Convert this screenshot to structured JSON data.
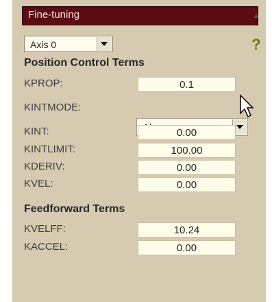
{
  "panel": {
    "title": "Fine-tuning",
    "axis_select": {
      "value": "Axis 0"
    }
  },
  "sections": {
    "position": {
      "title": "Position Control Terms",
      "kprop": {
        "label": "KPROP:",
        "value": "0.1"
      },
      "kintmode": {
        "label": "KINTMODE:",
        "value": "Always"
      },
      "kint": {
        "label": "KINT:",
        "value": "0.00"
      },
      "kintlimit": {
        "label": "KINTLIMIT:",
        "value": "100.00"
      },
      "kderiv": {
        "label": "KDERIV:",
        "value": "0.00"
      },
      "kvel": {
        "label": "KVEL:",
        "value": "0.00"
      }
    },
    "feedforward": {
      "title": "Feedforward Terms",
      "kvelff": {
        "label": "KVELFF:",
        "value": "10.24"
      },
      "kaccel": {
        "label": "KACCEL:",
        "value": "0.00"
      }
    }
  },
  "colors": {
    "panel_bg": "#d6cbb0",
    "titlebar_bg": "#5a0c12",
    "field_bg": "#fffdea"
  },
  "icons": [
    "collapse-icon",
    "help-icon",
    "dropdown-arrow-icon",
    "mouse-cursor-icon"
  ]
}
